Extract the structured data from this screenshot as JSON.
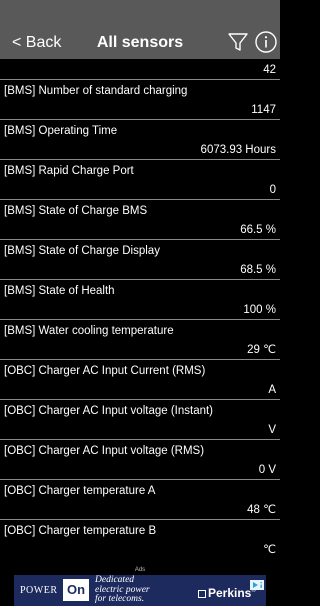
{
  "header": {
    "back_label": "< Back",
    "title": "All sensors",
    "filter_icon": "filter-icon",
    "info_icon": "info-icon",
    "background": "#595959"
  },
  "sensors": [
    {
      "name": "",
      "value": "42"
    },
    {
      "name": "[BMS] Number of standard charging",
      "value": "1147"
    },
    {
      "name": "[BMS] Operating Time",
      "value": "6073.93 Hours"
    },
    {
      "name": "[BMS] Rapid Charge Port",
      "value": "0"
    },
    {
      "name": "[BMS] State of Charge BMS",
      "value": "66.5 %"
    },
    {
      "name": "[BMS] State of Charge Display",
      "value": "68.5 %"
    },
    {
      "name": "[BMS] State of Health",
      "value": "100 %"
    },
    {
      "name": "[BMS] Water cooling temperature",
      "value": "29 ℃"
    },
    {
      "name": "[OBC] Charger AC Input Current (RMS)",
      "value": "A"
    },
    {
      "name": "[OBC] Charger AC Input voltage (Instant)",
      "value": "V"
    },
    {
      "name": "[OBC] Charger AC Input voltage (RMS)",
      "value": "0 V"
    },
    {
      "name": "[OBC] Charger temperature A",
      "value": "48 ℃"
    },
    {
      "name": "[OBC] Charger temperature B",
      "value": "℃"
    }
  ],
  "ad": {
    "label": "Ads",
    "power": "POWER",
    "on": "On",
    "tagline_1": "Dedicated",
    "tagline_2": "electric power",
    "tagline_3": "for telecoms.",
    "brand": "Perkins",
    "brand_mark": "®",
    "banner_color": "#1d2a5e"
  }
}
